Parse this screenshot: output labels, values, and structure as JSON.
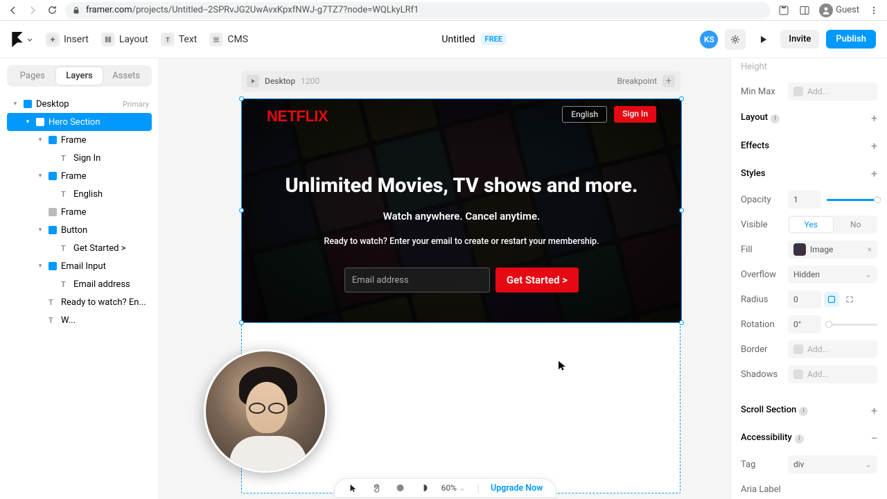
{
  "browser": {
    "url_domain": "framer.com",
    "url_path": "/projects/Untitled--2SPRvJG2UwAvxKpxfNWJ-g7TZ7?node=WQLkyLRf1",
    "guest": "Guest"
  },
  "header": {
    "tools": {
      "insert": "Insert",
      "layout": "Layout",
      "text": "Text",
      "cms": "CMS"
    },
    "title": "Untitled",
    "free": "FREE",
    "avatar": "KS",
    "invite": "Invite",
    "publish": "Publish"
  },
  "left_panel": {
    "tabs": {
      "pages": "Pages",
      "layers": "Layers",
      "assets": "Assets"
    },
    "tree": {
      "desktop": "Desktop",
      "primary": "Primary",
      "hero_section": "Hero Section",
      "frame": "Frame",
      "sign_in": "Sign In",
      "english": "English",
      "button": "Button",
      "get_started": "Get Started >",
      "email_input": "Email Input",
      "email_address": "Email address",
      "ready": "Ready to watch? En...",
      "w": "W..."
    }
  },
  "canvas": {
    "breakpoint_label": "Desktop",
    "breakpoint_size": "1200",
    "breakpoint_text": "Breakpoint",
    "hero": {
      "logo": "NETFLIX",
      "lang": "English",
      "signin": "Sign In",
      "headline": "Unlimited Movies, TV shows and more.",
      "sub": "Watch anywhere. Cancel anytime.",
      "prompt": "Ready to watch? Enter your email to create or restart your membership.",
      "placeholder": "Email address",
      "cta": "Get Started >"
    }
  },
  "bottom": {
    "zoom": "60%",
    "upgrade": "Upgrade Now"
  },
  "right_panel": {
    "height_label": "Height",
    "minmax": "Min Max",
    "add": "Add...",
    "layout": "Layout",
    "effects": "Effects",
    "styles": "Styles",
    "opacity": "Opacity",
    "opacity_val": "1",
    "visible": "Visible",
    "yes": "Yes",
    "no": "No",
    "fill": "Fill",
    "fill_val": "Image",
    "overflow": "Overflow",
    "overflow_val": "Hidden",
    "radius": "Radius",
    "radius_val": "0",
    "rotation": "Rotation",
    "rotation_val": "0°",
    "border": "Border",
    "shadows": "Shadows",
    "scroll": "Scroll Section",
    "accessibility": "Accessibility",
    "tag": "Tag",
    "tag_val": "div",
    "aria": "Aria Label"
  }
}
